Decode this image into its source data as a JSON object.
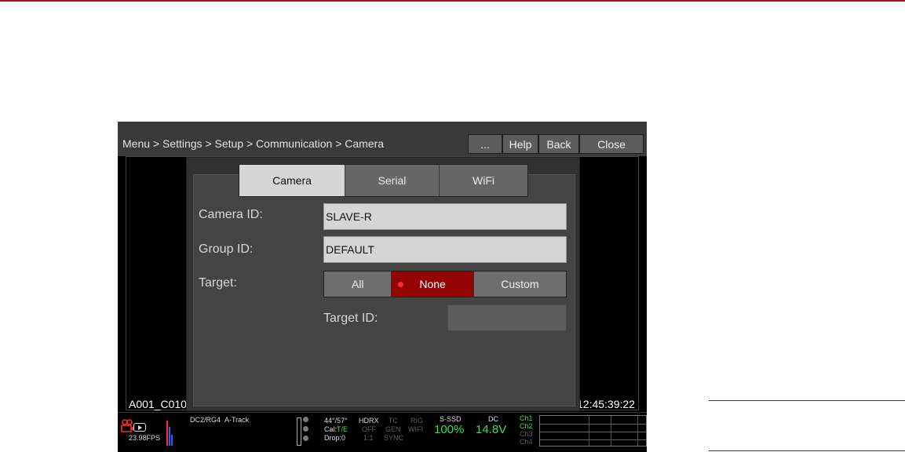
{
  "breadcrumb": "Menu > Settings > Setup > Communication > Camera",
  "header_buttons": {
    "more": "...",
    "help": "Help",
    "back": "Back",
    "close": "Close"
  },
  "tabs": [
    "Camera",
    "Serial",
    "WiFi"
  ],
  "fields": {
    "camera_id": {
      "label": "Camera ID:",
      "value": "SLAVE-R"
    },
    "group_id": {
      "label": "Group ID:",
      "value": "DEFAULT"
    },
    "target": {
      "label": "Target:",
      "options": [
        "All",
        "None",
        "Custom"
      ],
      "selected": "None"
    },
    "target_id": {
      "label": "Target ID:",
      "value": ""
    }
  },
  "overlay": {
    "clip_name": "A001_C010",
    "timecode": "12:45:39:22"
  },
  "status": {
    "fps": "23.98FPS",
    "codec": "DC2/RG4",
    "track": "A-Track",
    "temp": "44°/57°",
    "cal_label": "Cal:",
    "cal_value": "T/E",
    "drop": "Drop:0",
    "hdrx": "HDRX",
    "hdrx_state": "OFF",
    "hdrx_ratio": "1:1",
    "tc": "TC",
    "gen": "GEN",
    "sync": "SYNC",
    "rig": "RIG",
    "wifi": "WIFI",
    "media_label": "S-SSD",
    "media_value": "100%",
    "dc_label": "DC",
    "dc_value": "14.8V",
    "channels": [
      "Ch1",
      "Ch2",
      "Ch3",
      "Ch4"
    ]
  },
  "colors": {
    "accent_red": "#950404",
    "rule_red": "#9a1b1b",
    "ok_green": "#3ee14c"
  }
}
